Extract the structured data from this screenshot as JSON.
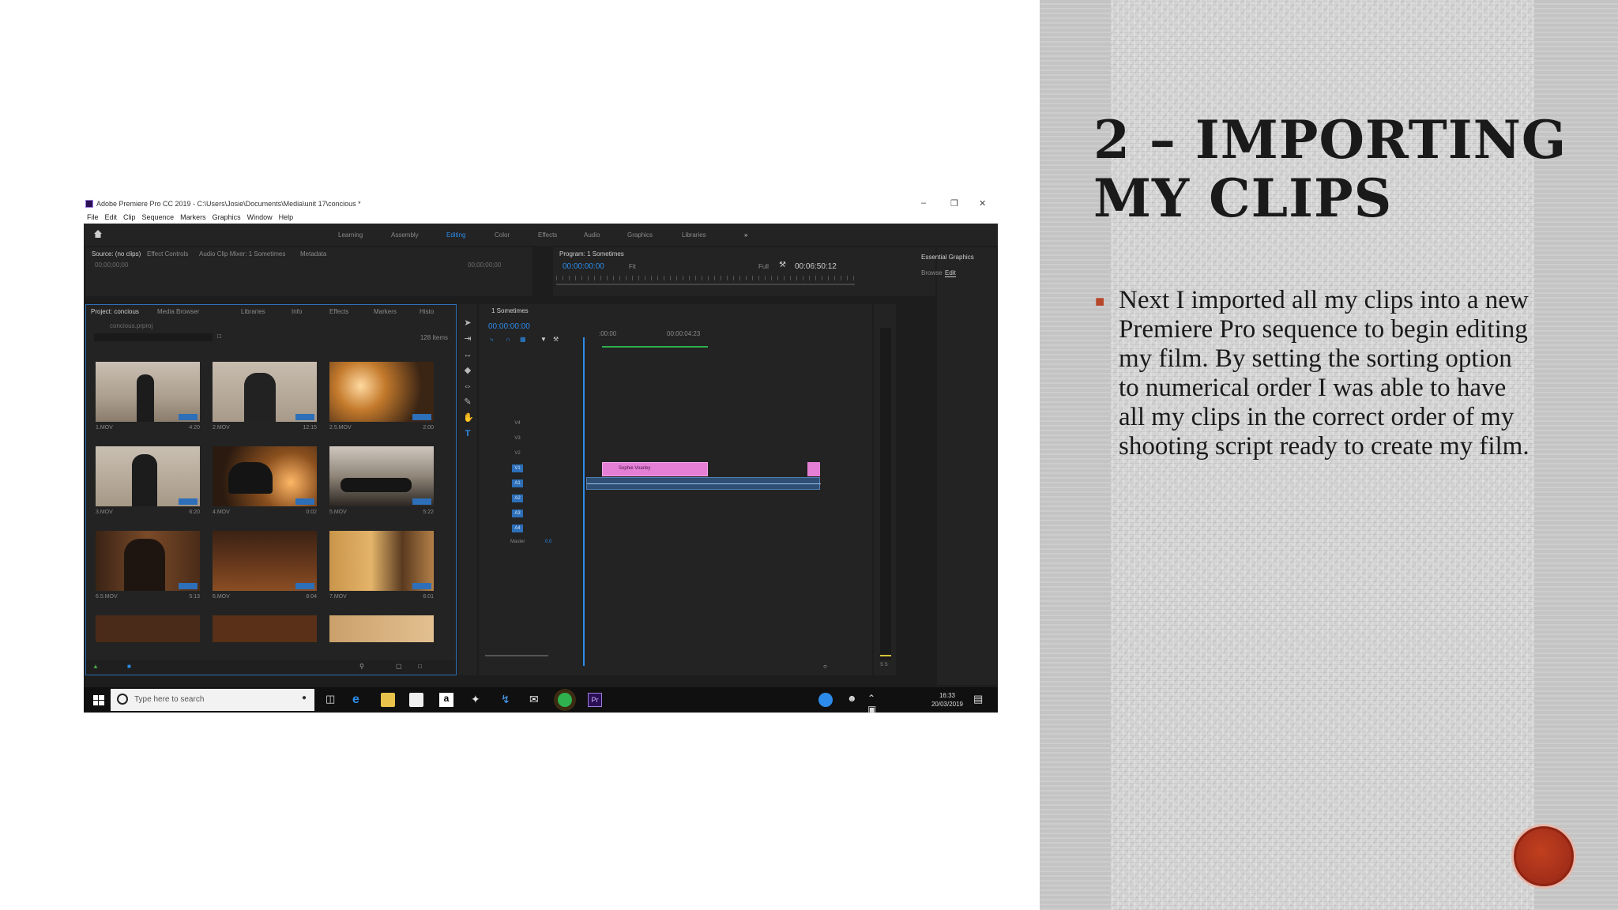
{
  "slide": {
    "title": "2 – IMPORTING MY CLIPS",
    "bullet": "Next I imported all my clips into a new Premiere Pro sequence to begin editing my film. By setting the sorting option to numerical order I was able to have all my clips in the correct order of my shooting script ready to create my film."
  },
  "colors": {
    "accent": "#b7472a",
    "premiere_blue": "#2d8ceb",
    "clip_pink": "#e57fd6"
  },
  "app": {
    "window_title": "Adobe Premiere Pro CC 2019 - C:\\Users\\Josie\\Documents\\Media\\unit 17\\concious *",
    "menu": [
      "File",
      "Edit",
      "Clip",
      "Sequence",
      "Markers",
      "Graphics",
      "Window",
      "Help"
    ],
    "workspaces": [
      "Learning",
      "Assembly",
      "Editing",
      "Color",
      "Effects",
      "Audio",
      "Graphics",
      "Libraries"
    ],
    "source_panel": {
      "tabs": [
        "Source: (no clips)",
        "Effect Controls",
        "Audio Clip Mixer: 1 Sometimes",
        "Metadata"
      ],
      "timecode_left": "00;00;00;00",
      "timecode_right": "00;00;00;00"
    },
    "program_panel": {
      "tab": "Program: 1 Sometimes",
      "timecode": "00:00:00:00",
      "fit": "Fit",
      "quality": "Full",
      "duration": "00:06:50:12"
    },
    "essential_graphics": {
      "tab": "Essential Graphics",
      "subtabs": [
        "Browse",
        "Edit"
      ]
    },
    "project_panel": {
      "tabs": [
        "Project: concious",
        "Media Browser",
        "Libraries",
        "Info",
        "Effects",
        "Markers",
        "Histo"
      ],
      "file": "concious.prproj",
      "item_count": "128 Items",
      "clips": [
        {
          "name": "1.MOV",
          "duration": "4:20"
        },
        {
          "name": "2.MOV",
          "duration": "12:15"
        },
        {
          "name": "2.5.MOV",
          "duration": "2:00"
        },
        {
          "name": "3.MOV",
          "duration": "6:20"
        },
        {
          "name": "4.MOV",
          "duration": "0:02"
        },
        {
          "name": "5.MOV",
          "duration": "5:22"
        },
        {
          "name": "6.5.MOV",
          "duration": "5:13"
        },
        {
          "name": "6.MOV",
          "duration": "8:04"
        },
        {
          "name": "7.MOV",
          "duration": "6:01"
        }
      ]
    },
    "timeline": {
      "tab": "1 Sometimes",
      "timecode": "00:00:00:00",
      "ruler_start": ":00:00",
      "ruler_mark": "00:00:04:23",
      "video_tracks": [
        "V4",
        "V3",
        "V2",
        "V1"
      ],
      "audio_tracks": [
        "A1",
        "A2",
        "A3",
        "A4"
      ],
      "master_label": "Master",
      "master_value": "0.0",
      "clip_label": "Sophie Voarley",
      "meter_label": "S S"
    },
    "taskbar": {
      "search_placeholder": "Type here to search",
      "time": "16:33",
      "date": "20/03/2019"
    }
  }
}
